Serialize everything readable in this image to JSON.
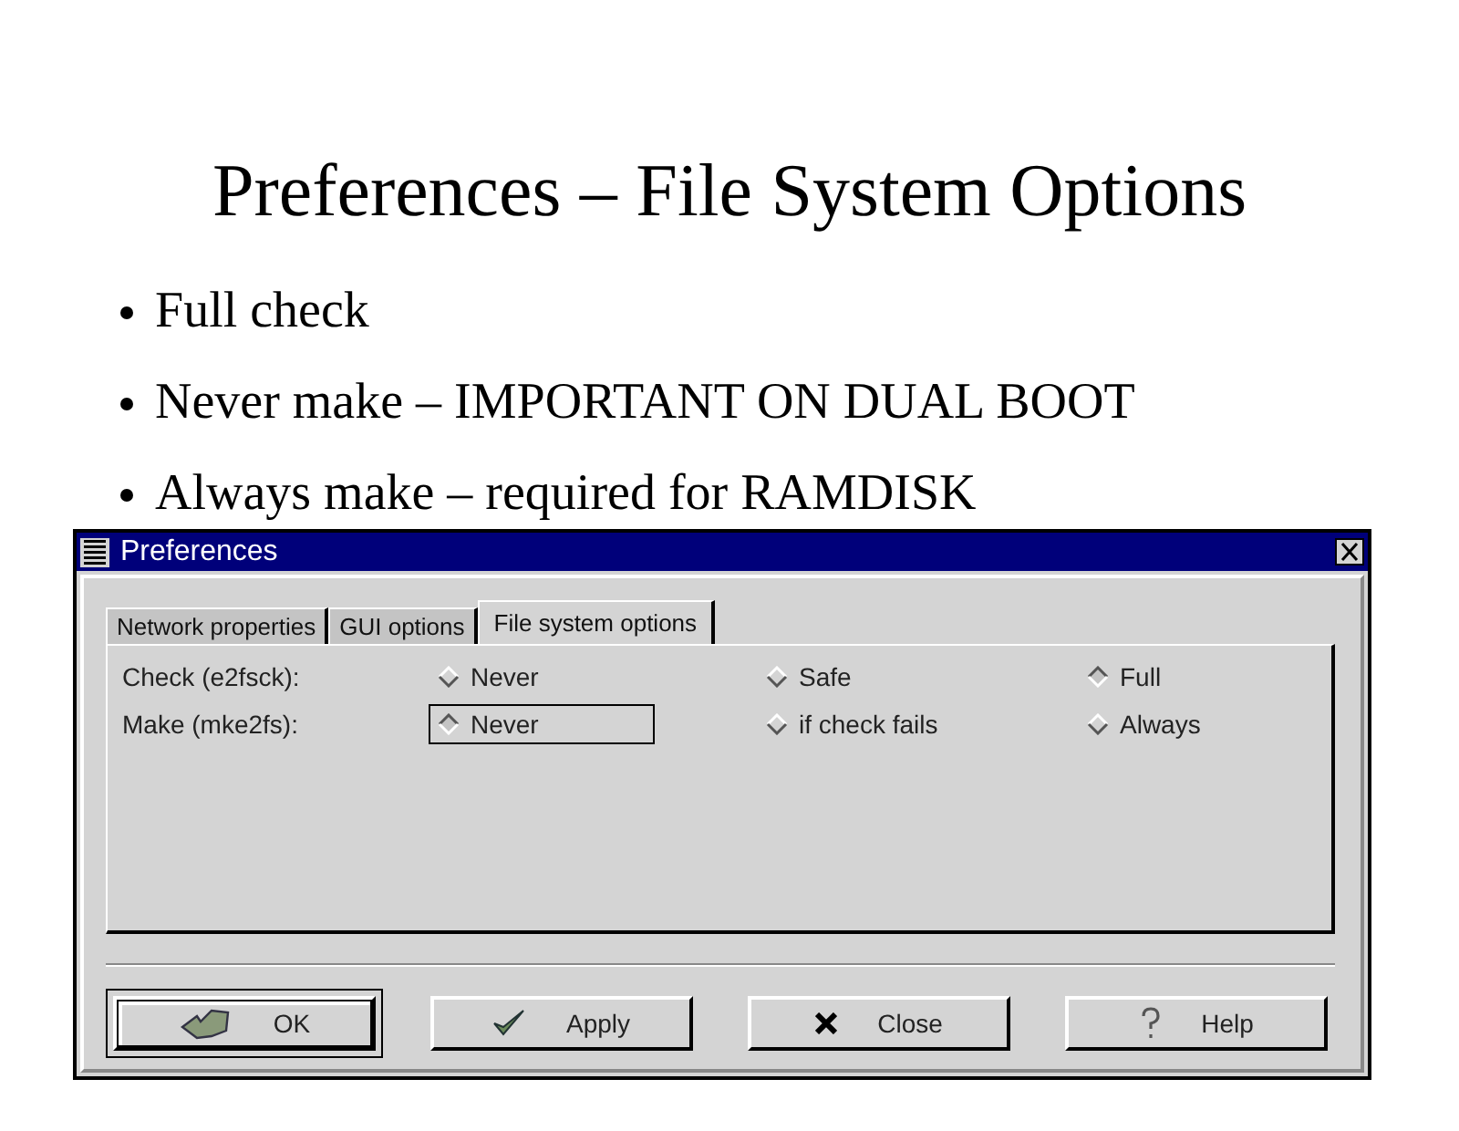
{
  "slide": {
    "title": "Preferences – File System Options",
    "bullets": [
      "Full check",
      "Never make – IMPORTANT ON DUAL BOOT",
      "Always make – required for RAMDISK"
    ]
  },
  "window": {
    "title": "Preferences"
  },
  "tabs": [
    {
      "label": "Network properties",
      "selected": false
    },
    {
      "label": "GUI options",
      "selected": false
    },
    {
      "label": "File system options",
      "selected": true
    }
  ],
  "options": [
    {
      "label": "Check (e2fsck):",
      "choices": [
        {
          "label": "Never",
          "selected": false,
          "focused": false
        },
        {
          "label": "Safe",
          "selected": false,
          "focused": false
        },
        {
          "label": "Full",
          "selected": true,
          "focused": false
        }
      ]
    },
    {
      "label": "Make (mke2fs):",
      "choices": [
        {
          "label": "Never",
          "selected": true,
          "focused": true
        },
        {
          "label": "if check fails",
          "selected": false,
          "focused": false
        },
        {
          "label": "Always",
          "selected": false,
          "focused": false
        }
      ]
    }
  ],
  "buttons": [
    {
      "kind": "ok",
      "label": "OK",
      "default": true
    },
    {
      "kind": "apply",
      "label": "Apply",
      "default": false
    },
    {
      "kind": "close",
      "label": "Close",
      "default": false
    },
    {
      "kind": "help",
      "label": "Help",
      "default": false
    }
  ]
}
